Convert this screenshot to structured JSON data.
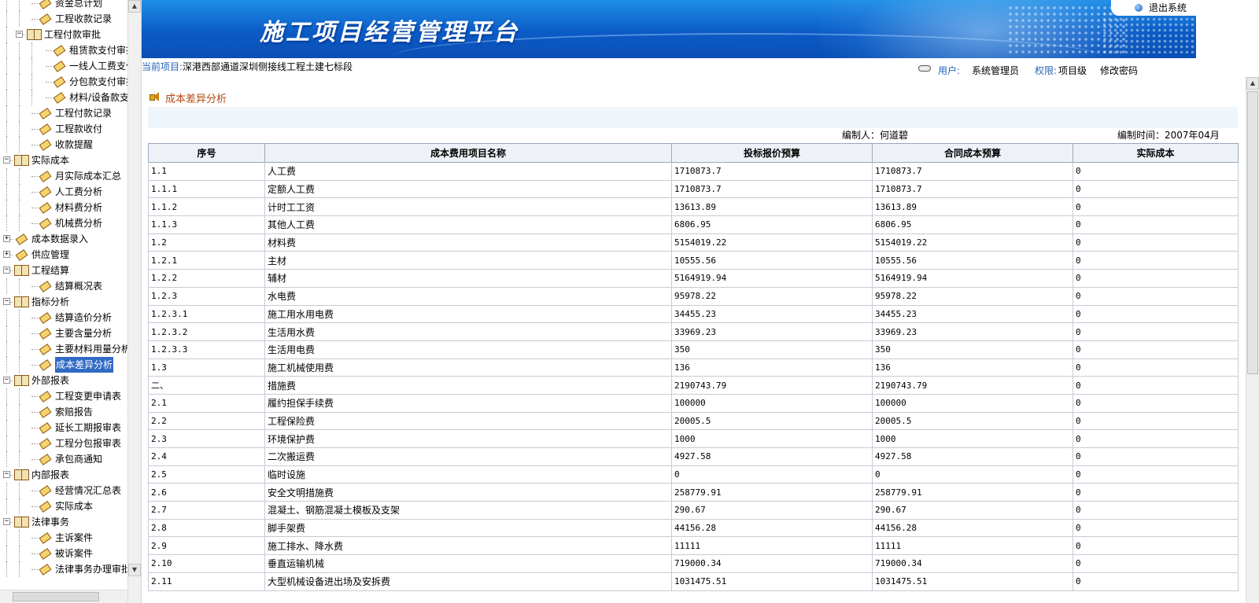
{
  "banner": {
    "title": "施工项目经营管理平台",
    "logout": "退出系统"
  },
  "infobar": {
    "project_label": "当前项目:",
    "project_value": "深港西部通道深圳侧接线工程土建七标段",
    "user_label": "用户:",
    "user_value": "系统管理员",
    "perm_label": "权限:",
    "perm_value": "项目级",
    "change_password": "修改密码"
  },
  "page": {
    "title": "成本差异分析",
    "compiler": "编制人：何道碧",
    "compile_time": "编制时间：2007年04月"
  },
  "tree": [
    {
      "label": "资金总计划",
      "level": 2,
      "type": "leaf"
    },
    {
      "label": "工程收款记录",
      "level": 2,
      "type": "leaf"
    },
    {
      "label": "工程付款审批",
      "level": 1,
      "type": "folder",
      "toggle": "−"
    },
    {
      "label": "租赁款支付审批",
      "level": 3,
      "type": "leaf"
    },
    {
      "label": "一线人工费支付",
      "level": 3,
      "type": "leaf"
    },
    {
      "label": "分包款支付审批",
      "level": 3,
      "type": "leaf"
    },
    {
      "label": "材料/设备款支付",
      "level": 3,
      "type": "leaf"
    },
    {
      "label": "工程付款记录",
      "level": 2,
      "type": "leaf"
    },
    {
      "label": "工程款收付",
      "level": 2,
      "type": "leaf"
    },
    {
      "label": "收款提醒",
      "level": 2,
      "type": "leaf"
    },
    {
      "label": "实际成本",
      "level": 0,
      "type": "folder",
      "toggle": "−"
    },
    {
      "label": "月实际成本汇总",
      "level": 2,
      "type": "leaf"
    },
    {
      "label": "人工费分析",
      "level": 2,
      "type": "leaf"
    },
    {
      "label": "材料费分析",
      "level": 2,
      "type": "leaf"
    },
    {
      "label": "机械费分析",
      "level": 2,
      "type": "leaf"
    },
    {
      "label": "成本数据录入",
      "level": 0,
      "type": "leaf",
      "toggle": "+"
    },
    {
      "label": "供应管理",
      "level": 0,
      "type": "leaf",
      "toggle": "+"
    },
    {
      "label": "工程结算",
      "level": 0,
      "type": "folder",
      "toggle": "−"
    },
    {
      "label": "结算概况表",
      "level": 2,
      "type": "leaf"
    },
    {
      "label": "指标分析",
      "level": 0,
      "type": "folder",
      "toggle": "−"
    },
    {
      "label": "结算造价分析",
      "level": 2,
      "type": "leaf"
    },
    {
      "label": "主要含量分析",
      "level": 2,
      "type": "leaf"
    },
    {
      "label": "主要材料用量分析",
      "level": 2,
      "type": "leaf"
    },
    {
      "label": "成本差异分析",
      "level": 2,
      "type": "leaf",
      "selected": true
    },
    {
      "label": "外部报表",
      "level": 0,
      "type": "folder",
      "toggle": "−"
    },
    {
      "label": "工程变更申请表",
      "level": 2,
      "type": "leaf"
    },
    {
      "label": "索赔报告",
      "level": 2,
      "type": "leaf"
    },
    {
      "label": "延长工期报审表",
      "level": 2,
      "type": "leaf"
    },
    {
      "label": "工程分包报审表",
      "level": 2,
      "type": "leaf"
    },
    {
      "label": "承包商通知",
      "level": 2,
      "type": "leaf"
    },
    {
      "label": "内部报表",
      "level": 0,
      "type": "folder",
      "toggle": "−"
    },
    {
      "label": "经营情况汇总表",
      "level": 2,
      "type": "leaf"
    },
    {
      "label": "实际成本",
      "level": 2,
      "type": "leaf"
    },
    {
      "label": "法律事务",
      "level": 0,
      "type": "folder",
      "toggle": "−"
    },
    {
      "label": "主诉案件",
      "level": 2,
      "type": "leaf"
    },
    {
      "label": "被诉案件",
      "level": 2,
      "type": "leaf"
    },
    {
      "label": "法律事务办理审批",
      "level": 2,
      "type": "leaf"
    }
  ],
  "table": {
    "headers": [
      "序号",
      "成本费用项目名称",
      "投标报价预算",
      "合同成本预算",
      "实际成本"
    ],
    "rows": [
      [
        "1.1",
        "人工费",
        "1710873.7",
        "1710873.7",
        "0"
      ],
      [
        "1.1.1",
        "定额人工费",
        "1710873.7",
        "1710873.7",
        "0"
      ],
      [
        "1.1.2",
        "计时工工资",
        "13613.89",
        "13613.89",
        "0"
      ],
      [
        "1.1.3",
        "其他人工费",
        "6806.95",
        "6806.95",
        "0"
      ],
      [
        "1.2",
        "材料费",
        "5154019.22",
        "5154019.22",
        "0"
      ],
      [
        "1.2.1",
        "主材",
        "10555.56",
        "10555.56",
        "0"
      ],
      [
        "1.2.2",
        "辅材",
        "5164919.94",
        "5164919.94",
        "0"
      ],
      [
        "1.2.3",
        "水电费",
        "95978.22",
        "95978.22",
        "0"
      ],
      [
        "1.2.3.1",
        "施工用水用电费",
        "34455.23",
        "34455.23",
        "0"
      ],
      [
        "1.2.3.2",
        "生活用水费",
        "33969.23",
        "33969.23",
        "0"
      ],
      [
        "1.2.3.3",
        "生活用电费",
        "350",
        "350",
        "0"
      ],
      [
        "1.3",
        "施工机械使用费",
        "136",
        "136",
        "0"
      ],
      [
        "二、",
        "措施费",
        "2190743.79",
        "2190743.79",
        "0"
      ],
      [
        "2.1",
        "履约担保手续费",
        "100000",
        "100000",
        "0"
      ],
      [
        "2.2",
        "工程保险费",
        "20005.5",
        "20005.5",
        "0"
      ],
      [
        "2.3",
        "环境保护费",
        "1000",
        "1000",
        "0"
      ],
      [
        "2.4",
        "二次搬运费",
        "4927.58",
        "4927.58",
        "0"
      ],
      [
        "2.5",
        "临时设施",
        "0",
        "0",
        "0"
      ],
      [
        "2.6",
        "安全文明措施费",
        "258779.91",
        "258779.91",
        "0"
      ],
      [
        "2.7",
        "混凝土、钢筋混凝土模板及支架",
        "290.67",
        "290.67",
        "0"
      ],
      [
        "2.8",
        "脚手架费",
        "44156.28",
        "44156.28",
        "0"
      ],
      [
        "2.9",
        "施工排水、降水费",
        "11111",
        "11111",
        "0"
      ],
      [
        "2.10",
        "垂直运输机械",
        "719000.34",
        "719000.34",
        "0"
      ],
      [
        "2.11",
        "大型机械设备进出场及安拆费",
        "1031475.51",
        "1031475.51",
        "0"
      ]
    ]
  }
}
